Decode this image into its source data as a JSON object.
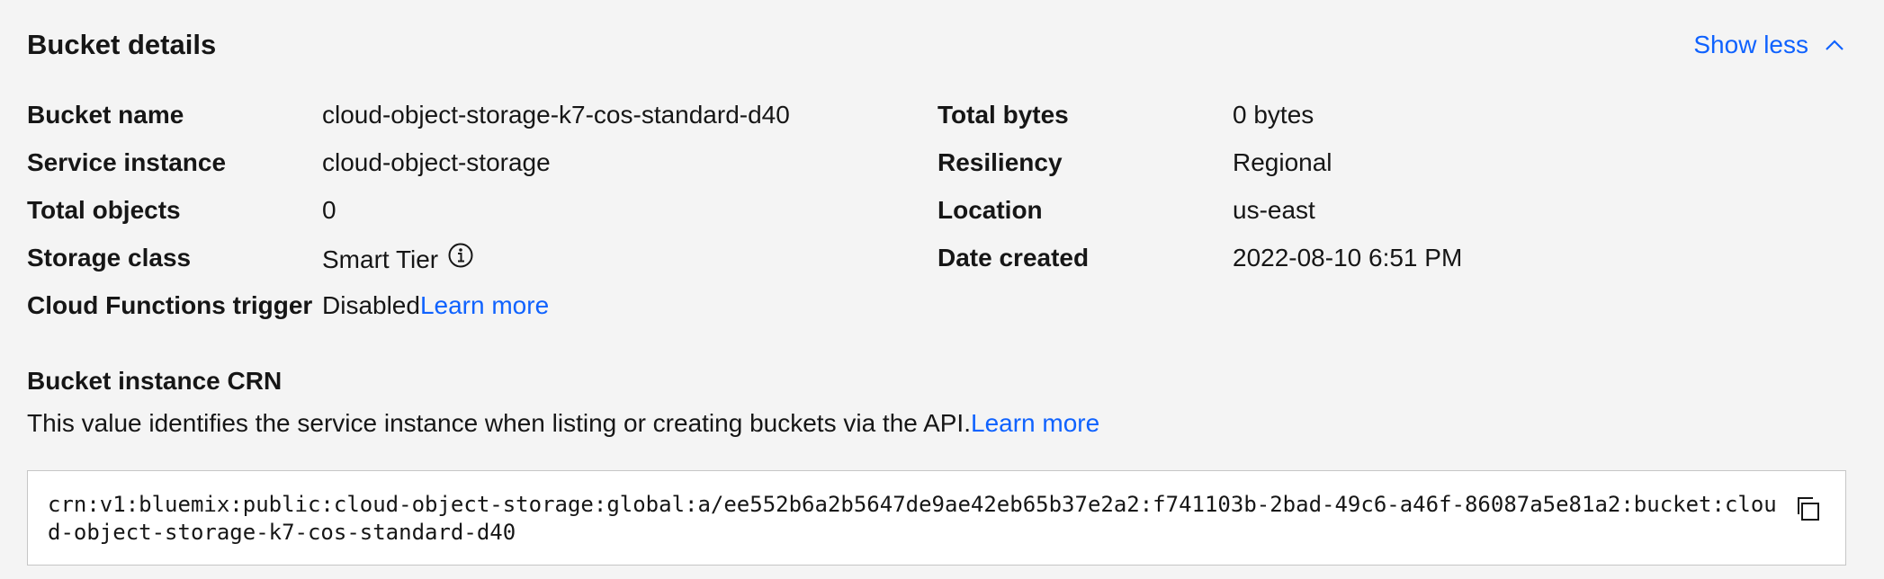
{
  "header": {
    "title": "Bucket details",
    "toggle_label": "Show less",
    "toggle_icon": "chevron-up-icon"
  },
  "details_left": {
    "bucket_name": {
      "label": "Bucket name",
      "value": "cloud-object-storage-k7-cos-standard-d40"
    },
    "service_instance": {
      "label": "Service instance",
      "value": "cloud-object-storage"
    },
    "total_objects": {
      "label": "Total objects",
      "value": "0"
    },
    "storage_class": {
      "label": "Storage class",
      "value": "Smart Tier",
      "icon": "info-icon"
    },
    "cloud_functions": {
      "label": "Cloud Functions trigger",
      "value": "Disabled",
      "link": "Learn more"
    }
  },
  "details_right": {
    "total_bytes": {
      "label": "Total bytes",
      "value": "0 bytes"
    },
    "resiliency": {
      "label": "Resiliency",
      "value": "Regional"
    },
    "location": {
      "label": "Location",
      "value": "us-east"
    },
    "date_created": {
      "label": "Date created",
      "value": "2022-08-10 6:51 PM"
    }
  },
  "crn": {
    "heading": "Bucket instance CRN",
    "description": "This value identifies the service instance when listing or creating buckets via the API.",
    "link": "Learn more",
    "value": "crn:v1:bluemix:public:cloud-object-storage:global:a/ee552b6a2b5647de9ae42eb65b37e2a2:f741103b-2bad-49c6-a46f-86087a5e81a2:bucket:cloud-object-storage-k7-cos-standard-d40",
    "copy_icon": "copy-icon"
  },
  "colors": {
    "link": "#0f62fe",
    "background": "#f4f4f4",
    "text": "#161616"
  }
}
